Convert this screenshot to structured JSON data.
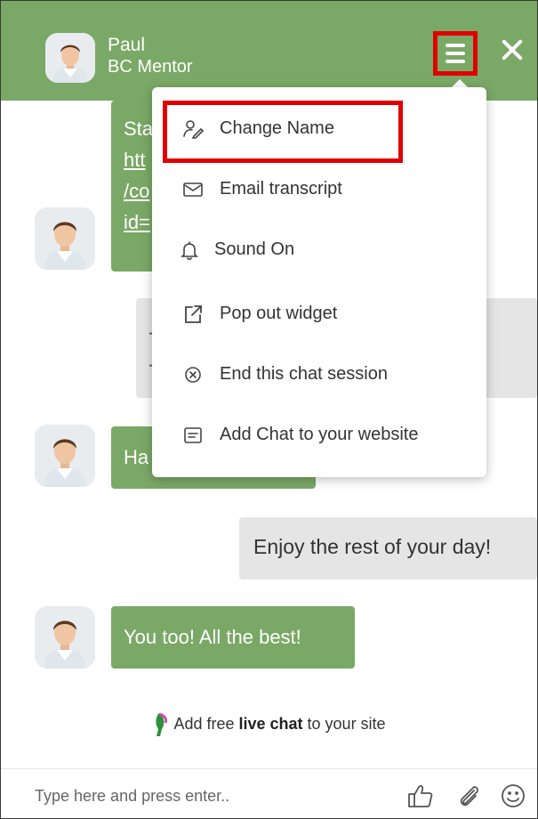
{
  "header": {
    "name": "Paul",
    "role": "BC Mentor"
  },
  "messages": {
    "partial_1_lines": [
      "Sta",
      "htt",
      "/co",
      "id="
    ],
    "partial_grey": [
      "-",
      "-"
    ],
    "partial_2": "Ha",
    "user_reply": "Enjoy the rest of your day!",
    "agent_reply": "You too! All the best!"
  },
  "menu": {
    "items": [
      {
        "label": "Change Name",
        "icon": "user-edit-icon"
      },
      {
        "label": "Email transcript",
        "icon": "envelope-icon"
      },
      {
        "label": "Sound On",
        "icon": "bell-icon"
      },
      {
        "label": "Pop out widget",
        "icon": "external-link-icon"
      },
      {
        "label": "End this chat session",
        "icon": "close-circle-icon"
      },
      {
        "label": "Add Chat to your website",
        "icon": "chat-box-icon"
      }
    ]
  },
  "footer": {
    "promo_prefix": "Add free ",
    "promo_bold": "live chat",
    "promo_suffix": " to your site",
    "input_placeholder": "Type here and press enter.."
  },
  "colors": {
    "accent": "#7aa866",
    "highlight": "#e00000"
  }
}
